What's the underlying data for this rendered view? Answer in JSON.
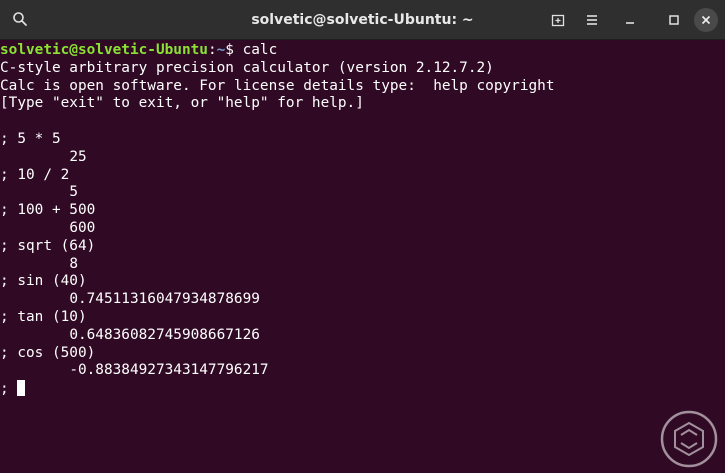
{
  "window": {
    "title": "solvetic@solvetic-Ubuntu: ~"
  },
  "colors": {
    "terminal_bg": "#300a24",
    "prompt_user": "#8ae234",
    "prompt_path": "#729fcf",
    "text": "#ffffff"
  },
  "icons": {
    "search": "search-icon",
    "new_tab": "new-tab-icon",
    "menu": "hamburger-menu-icon",
    "minimize": "minimize-icon",
    "maximize": "maximize-icon",
    "close": "close-icon",
    "watermark": "solvetic-logo"
  },
  "terminal": {
    "prompt_user_host": "solvetic@solvetic-Ubuntu",
    "prompt_sep": ":",
    "prompt_path": "~",
    "prompt_symbol": "$ ",
    "command": "calc",
    "banner": [
      "C-style arbitrary precision calculator (version 2.12.7.2)",
      "Calc is open software. For license details type:  help copyright",
      "[Type \"exit\" to exit, or \"help\" for help.]",
      ""
    ],
    "session": [
      "; 5 * 5",
      "\t25",
      "; 10 / 2",
      "\t5",
      "; 100 + 500",
      "\t600",
      "; sqrt (64)",
      "\t8",
      "; sin (40)",
      "\t0.74511316047934878699",
      "; tan (10)",
      "\t0.64836082745908667126",
      "; cos (500)",
      "\t-0.88384927343147796217"
    ],
    "current_prompt": "; "
  }
}
